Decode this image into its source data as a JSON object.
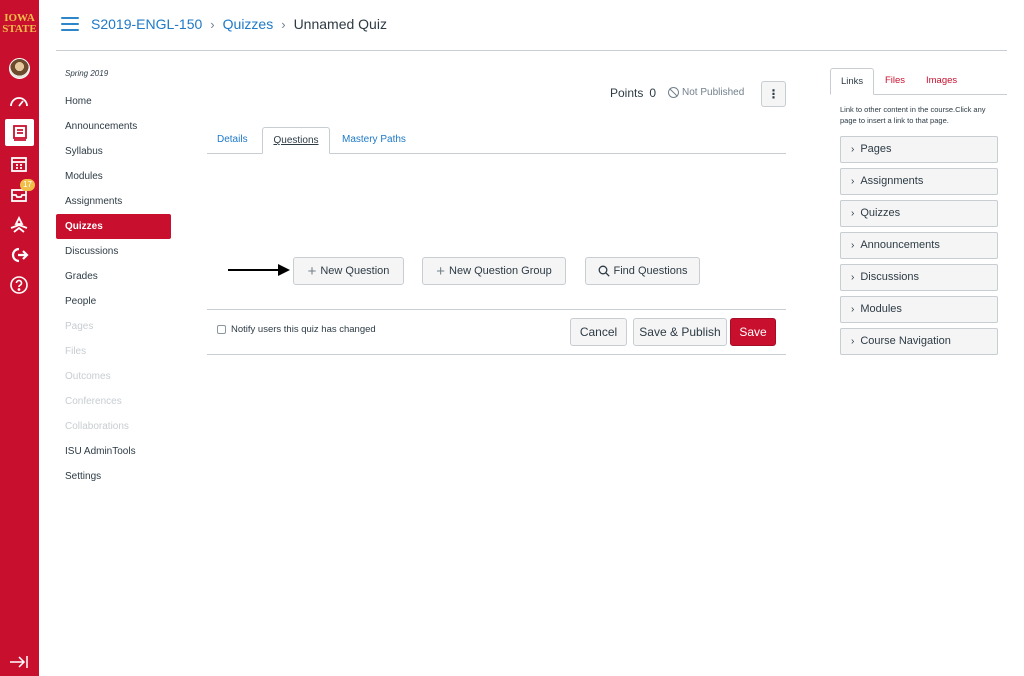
{
  "global_nav": {
    "logo_line1": "IOWA",
    "logo_line2": "STATE",
    "badge_count": "17"
  },
  "header": {
    "breadcrumb": [
      "S2019-ENGL-150",
      "Quizzes",
      "Unnamed Quiz"
    ]
  },
  "course_nav": {
    "term": "Spring 2019",
    "items": [
      {
        "label": "Home",
        "state": "normal"
      },
      {
        "label": "Announcements",
        "state": "normal"
      },
      {
        "label": "Syllabus",
        "state": "normal"
      },
      {
        "label": "Modules",
        "state": "normal"
      },
      {
        "label": "Assignments",
        "state": "normal"
      },
      {
        "label": "Quizzes",
        "state": "active"
      },
      {
        "label": "Discussions",
        "state": "normal"
      },
      {
        "label": "Grades",
        "state": "normal"
      },
      {
        "label": "People",
        "state": "normal"
      },
      {
        "label": "Pages",
        "state": "muted"
      },
      {
        "label": "Files",
        "state": "muted"
      },
      {
        "label": "Outcomes",
        "state": "muted"
      },
      {
        "label": "Conferences",
        "state": "muted"
      },
      {
        "label": "Collaborations",
        "state": "muted"
      },
      {
        "label": "ISU AdminTools",
        "state": "normal"
      },
      {
        "label": "Settings",
        "state": "normal"
      }
    ]
  },
  "quiz": {
    "points_label": "Points",
    "points_value": "0",
    "publish_status": "Not Published",
    "kebab": "⋮",
    "tabs": [
      "Details",
      "Questions",
      "Mastery Paths"
    ],
    "active_tab": "Questions",
    "actions": {
      "new_question": "New Question",
      "new_question_group": "New Question Group",
      "find_questions": "Find Questions"
    },
    "notify_label": "Notify users this quiz has changed",
    "cancel": "Cancel",
    "save_publish": "Save & Publish",
    "save": "Save"
  },
  "right_panel": {
    "tabs": [
      "Links",
      "Files",
      "Images"
    ],
    "active_tab": "Links",
    "help": "Link to other content in the course.Click any page to insert a link to that page.",
    "sections": [
      "Pages",
      "Assignments",
      "Quizzes",
      "Announcements",
      "Discussions",
      "Modules",
      "Course Navigation"
    ]
  },
  "colors": {
    "brand_red": "#c8102e",
    "link_blue": "#1e79c7",
    "gold": "#f1be48"
  }
}
